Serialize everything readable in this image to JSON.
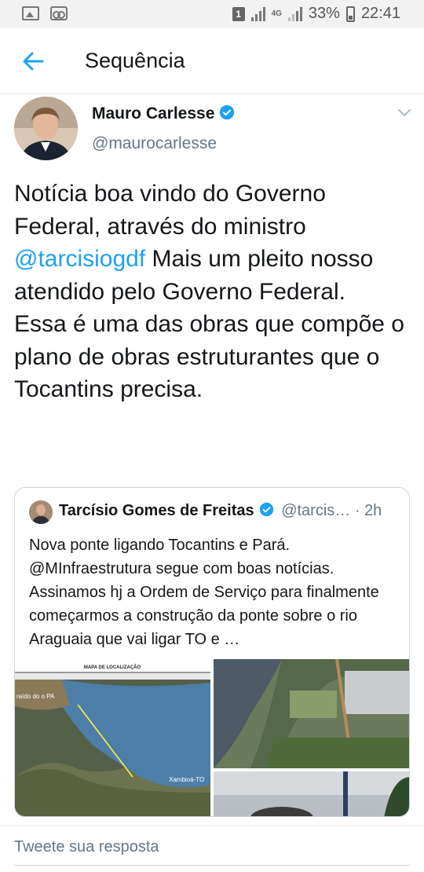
{
  "status_bar": {
    "sim": "1",
    "network": "4G",
    "battery": "33%",
    "time": "22:41"
  },
  "header": {
    "back_icon": "arrow-left-icon",
    "title": "Sequência"
  },
  "tweet": {
    "author_name": "Mauro Carlesse",
    "author_handle": "@maurocarlesse",
    "verified": true,
    "text_before_mention": "Notícia boa vindo do Governo Federal, através do ministro ",
    "mention": "@tarcisiogdf",
    "text_after_mention": " Mais um pleito nosso atendido pelo Governo Federal.",
    "text_paragraph_2": "Essa é uma das obras que compõe o plano de obras estruturantes que o Tocantins precisa."
  },
  "quoted_tweet": {
    "author_name": "Tarcísio Gomes de Freitas",
    "author_handle": "@tarcis…",
    "separator": " · ",
    "time": "2h",
    "text": "Nova ponte ligando Tocantins e Pará. @MInfraestrutura segue com boas notícias. Assinamos hj a Ordem de Serviço para finalmente começarmos a construção da ponte sobre o rio Araguaia que vai ligar TO e …",
    "map_title": "MAPA DE LOCALIZAÇÃO",
    "map_label_left": "raído do\no PA",
    "map_label_right": "Xambioá-TO"
  },
  "reply": {
    "placeholder": "Tweete sua resposta"
  },
  "colors": {
    "accent": "#1da1f2",
    "text": "#14171a",
    "secondary": "#657786"
  }
}
